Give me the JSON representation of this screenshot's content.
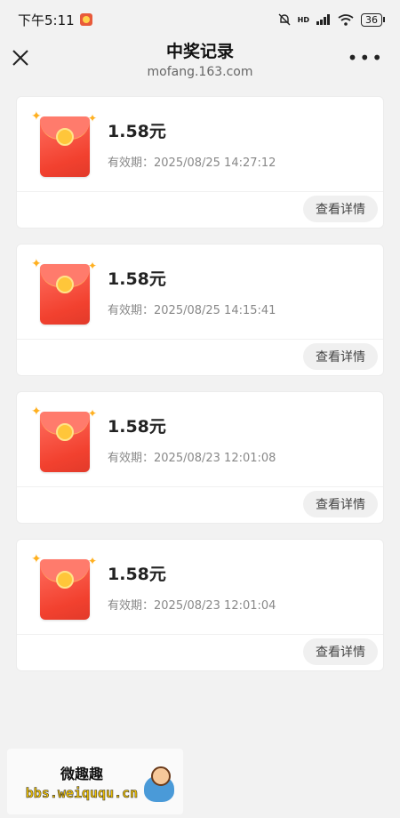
{
  "status_bar": {
    "time": "下午5:11",
    "network": "HD",
    "battery": "36"
  },
  "nav": {
    "title": "中奖记录",
    "subtitle": "mofang.163.com",
    "more_label": "•••"
  },
  "records": [
    {
      "amount": "1.58元",
      "validity": "有效期：2025/08/25 14:27:12",
      "button": "查看详情"
    },
    {
      "amount": "1.58元",
      "validity": "有效期：2025/08/25 14:15:41",
      "button": "查看详情"
    },
    {
      "amount": "1.58元",
      "validity": "有效期：2025/08/23 12:01:08",
      "button": "查看详情"
    },
    {
      "amount": "1.58元",
      "validity": "有效期：2025/08/23 12:01:04",
      "button": "查看详情"
    }
  ],
  "watermark": {
    "title": "微趣趣",
    "url": "bbs.weiququ.cn"
  },
  "colors": {
    "envelope": "#f2412f",
    "coin": "#ffc63a",
    "background": "#f2f2f2"
  },
  "icons": {
    "close": "close-icon",
    "more": "more-icon",
    "envelope": "red-envelope-icon",
    "sparkle": "sparkle-icon"
  }
}
